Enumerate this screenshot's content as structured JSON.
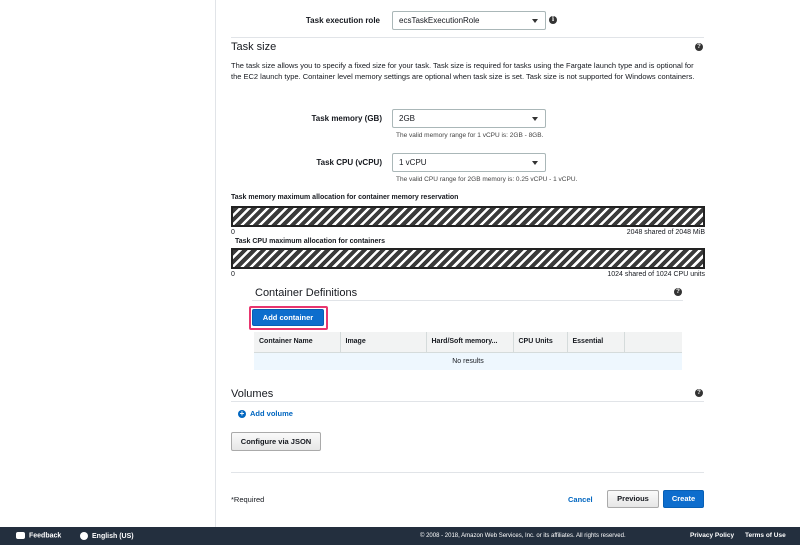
{
  "exec_role": {
    "label": "Task execution role",
    "value": "ecsTaskExecutionRole"
  },
  "task_size": {
    "title": "Task size",
    "description": "The task size allows you to specify a fixed size for your task. Task size is required for tasks using the Fargate launch type and is optional for the EC2 launch type. Container level memory settings are optional when task size is set. Task size is not supported for Windows containers.",
    "memory": {
      "label": "Task memory (GB)",
      "value": "2GB",
      "help": "The valid memory range for 1 vCPU is: 2GB - 8GB."
    },
    "cpu": {
      "label": "Task CPU (vCPU)",
      "value": "1 vCPU",
      "help": "The valid CPU range for 2GB memory is: 0.25 vCPU - 1 vCPU."
    }
  },
  "memory_alloc": {
    "title": "Task memory maximum allocation for container memory reservation",
    "min": "0",
    "summary": "2048 shared of 2048 MiB",
    "fill": 1.0
  },
  "cpu_alloc": {
    "title": "Task CPU maximum allocation for containers",
    "min": "0",
    "summary": "1024 shared of 1024 CPU units",
    "fill": 1.0
  },
  "container_defs": {
    "title": "Container Definitions",
    "add_button": "Add container",
    "columns": [
      "Container Name",
      "Image",
      "Hard/Soft memory...",
      "CPU Units",
      "Essential"
    ],
    "empty_text": "No results"
  },
  "volumes": {
    "title": "Volumes",
    "add_link": "Add volume"
  },
  "configure_json": "Configure via JSON",
  "form_footer": {
    "required": "*Required",
    "cancel": "Cancel",
    "previous": "Previous",
    "create": "Create"
  },
  "page_footer": {
    "feedback": "Feedback",
    "language": "English (US)",
    "copyright": "© 2008 - 2018, Amazon Web Services, Inc. or its affiliates. All rights reserved.",
    "privacy": "Privacy Policy",
    "terms": "Terms of Use"
  },
  "colors": {
    "primary": "#0d6dcd",
    "link": "#0066c0",
    "highlight": "#e8366f",
    "footer_bg": "#232f3e"
  },
  "icons": {
    "help": "question-circle-icon",
    "info": "info-circle-icon",
    "add": "plus-circle-icon"
  }
}
